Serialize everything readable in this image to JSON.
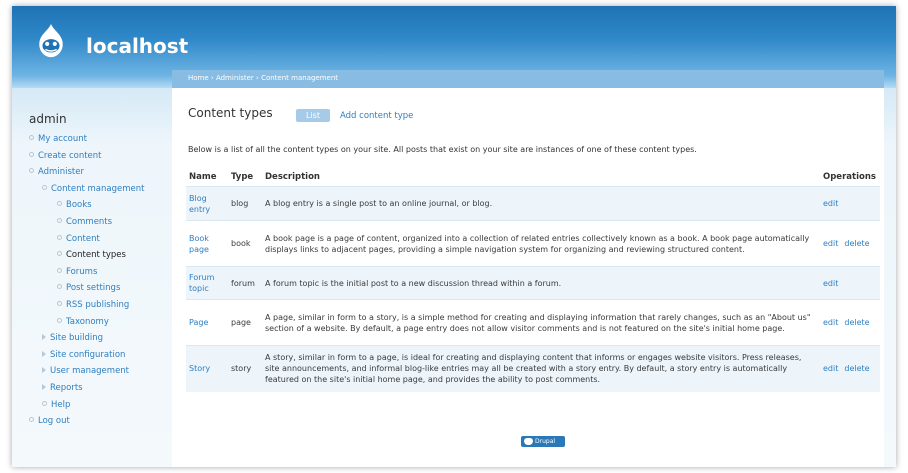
{
  "site": {
    "name": "localhost"
  },
  "breadcrumb": {
    "items": [
      "Home",
      "Administer",
      "Content management"
    ],
    "separator": "›"
  },
  "sidebar": {
    "title": "admin",
    "items": [
      {
        "label": "My account",
        "level": 0,
        "marker": "bullet"
      },
      {
        "label": "Create content",
        "level": 0,
        "marker": "bullet"
      },
      {
        "label": "Administer",
        "level": 0,
        "marker": "bullet"
      },
      {
        "label": "Content management",
        "level": 1,
        "marker": "bullet"
      },
      {
        "label": "Books",
        "level": 2,
        "marker": "bullet"
      },
      {
        "label": "Comments",
        "level": 2,
        "marker": "bullet"
      },
      {
        "label": "Content",
        "level": 2,
        "marker": "bullet"
      },
      {
        "label": "Content types",
        "level": 2,
        "marker": "bullet",
        "active": true
      },
      {
        "label": "Forums",
        "level": 2,
        "marker": "bullet"
      },
      {
        "label": "Post settings",
        "level": 2,
        "marker": "bullet"
      },
      {
        "label": "RSS publishing",
        "level": 2,
        "marker": "bullet"
      },
      {
        "label": "Taxonomy",
        "level": 2,
        "marker": "bullet"
      },
      {
        "label": "Site building",
        "level": 1,
        "marker": "triangle"
      },
      {
        "label": "Site configuration",
        "level": 1,
        "marker": "triangle"
      },
      {
        "label": "User management",
        "level": 1,
        "marker": "triangle"
      },
      {
        "label": "Reports",
        "level": 1,
        "marker": "triangle"
      },
      {
        "label": "Help",
        "level": 1,
        "marker": "bullet"
      },
      {
        "label": "Log out",
        "level": 0,
        "marker": "bullet"
      }
    ]
  },
  "main": {
    "title": "Content types",
    "tabs": {
      "list": "List",
      "add": "Add content type"
    },
    "intro": "Below is a list of all the content types on your site. All posts that exist on your site are instances of one of these content types.",
    "table": {
      "headers": {
        "name": "Name",
        "type": "Type",
        "description": "Description",
        "operations": "Operations"
      },
      "rows": [
        {
          "name": "Blog entry",
          "type": "blog",
          "description": "A blog entry is a single post to an online journal, or blog.",
          "edit": "edit",
          "delete": ""
        },
        {
          "name": "Book page",
          "type": "book",
          "description": "A book page is a page of content, organized into a collection of related entries collectively known as a book. A book page automatically displays links to adjacent pages, providing a simple navigation system for organizing and reviewing structured content.",
          "edit": "edit",
          "delete": "delete"
        },
        {
          "name": "Forum topic",
          "type": "forum",
          "description": "A forum topic is the initial post to a new discussion thread within a forum.",
          "edit": "edit",
          "delete": ""
        },
        {
          "name": "Page",
          "type": "page",
          "description": "A page, similar in form to a story, is a simple method for creating and displaying information that rarely changes, such as an \"About us\" section of a website. By default, a page entry does not allow visitor comments and is not featured on the site's initial home page.",
          "edit": "edit",
          "delete": "delete"
        },
        {
          "name": "Story",
          "type": "story",
          "description": "A story, similar in form to a page, is ideal for creating and displaying content that informs or engages website visitors. Press releases, site announcements, and informal blog-like entries may all be created with a story entry. By default, a story entry is automatically featured on the site's initial home page, and provides the ability to post comments.",
          "edit": "edit",
          "delete": "delete"
        }
      ]
    }
  },
  "footer": {
    "badge": "Drupal"
  },
  "colors": {
    "header": "#2f88c8",
    "link": "#2e7ec0",
    "row_alt": "#edf5fb",
    "tab_active": "#a6cbe8"
  }
}
